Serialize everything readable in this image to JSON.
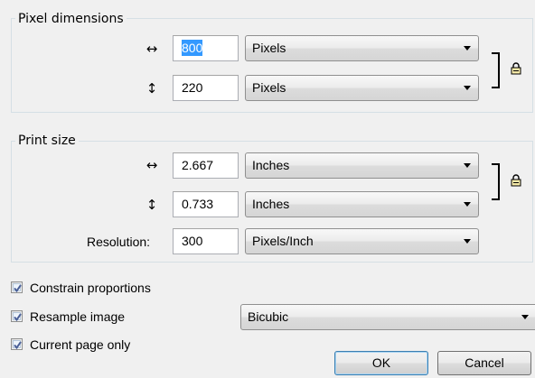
{
  "pixel_dimensions": {
    "title": "Pixel dimensions",
    "width_value": "800",
    "width_unit": "Pixels",
    "height_value": "220",
    "height_unit": "Pixels",
    "width_icon": "horizontal-arrows-icon",
    "height_icon": "vertical-arrows-icon",
    "lock_icon": "lock-icon"
  },
  "print_size": {
    "title": "Print size",
    "width_value": "2.667",
    "width_unit": "Inches",
    "height_value": "0.733",
    "height_unit": "Inches",
    "resolution_label": "Resolution:",
    "resolution_value": "300",
    "resolution_unit": "Pixels/Inch",
    "lock_icon": "lock-icon"
  },
  "options": {
    "constrain_label": "Constrain proportions",
    "constrain_checked": true,
    "resample_label": "Resample image",
    "resample_checked": true,
    "resample_method": "Bicubic",
    "current_page_label": "Current page only",
    "current_page_checked": true
  },
  "buttons": {
    "ok_label": "OK",
    "cancel_label": "Cancel"
  },
  "colors": {
    "selection": "#3399ff",
    "group_border": "#d5dfe5",
    "default_button_border": "#3c7fb1",
    "checkmark": "#4a5f97"
  }
}
